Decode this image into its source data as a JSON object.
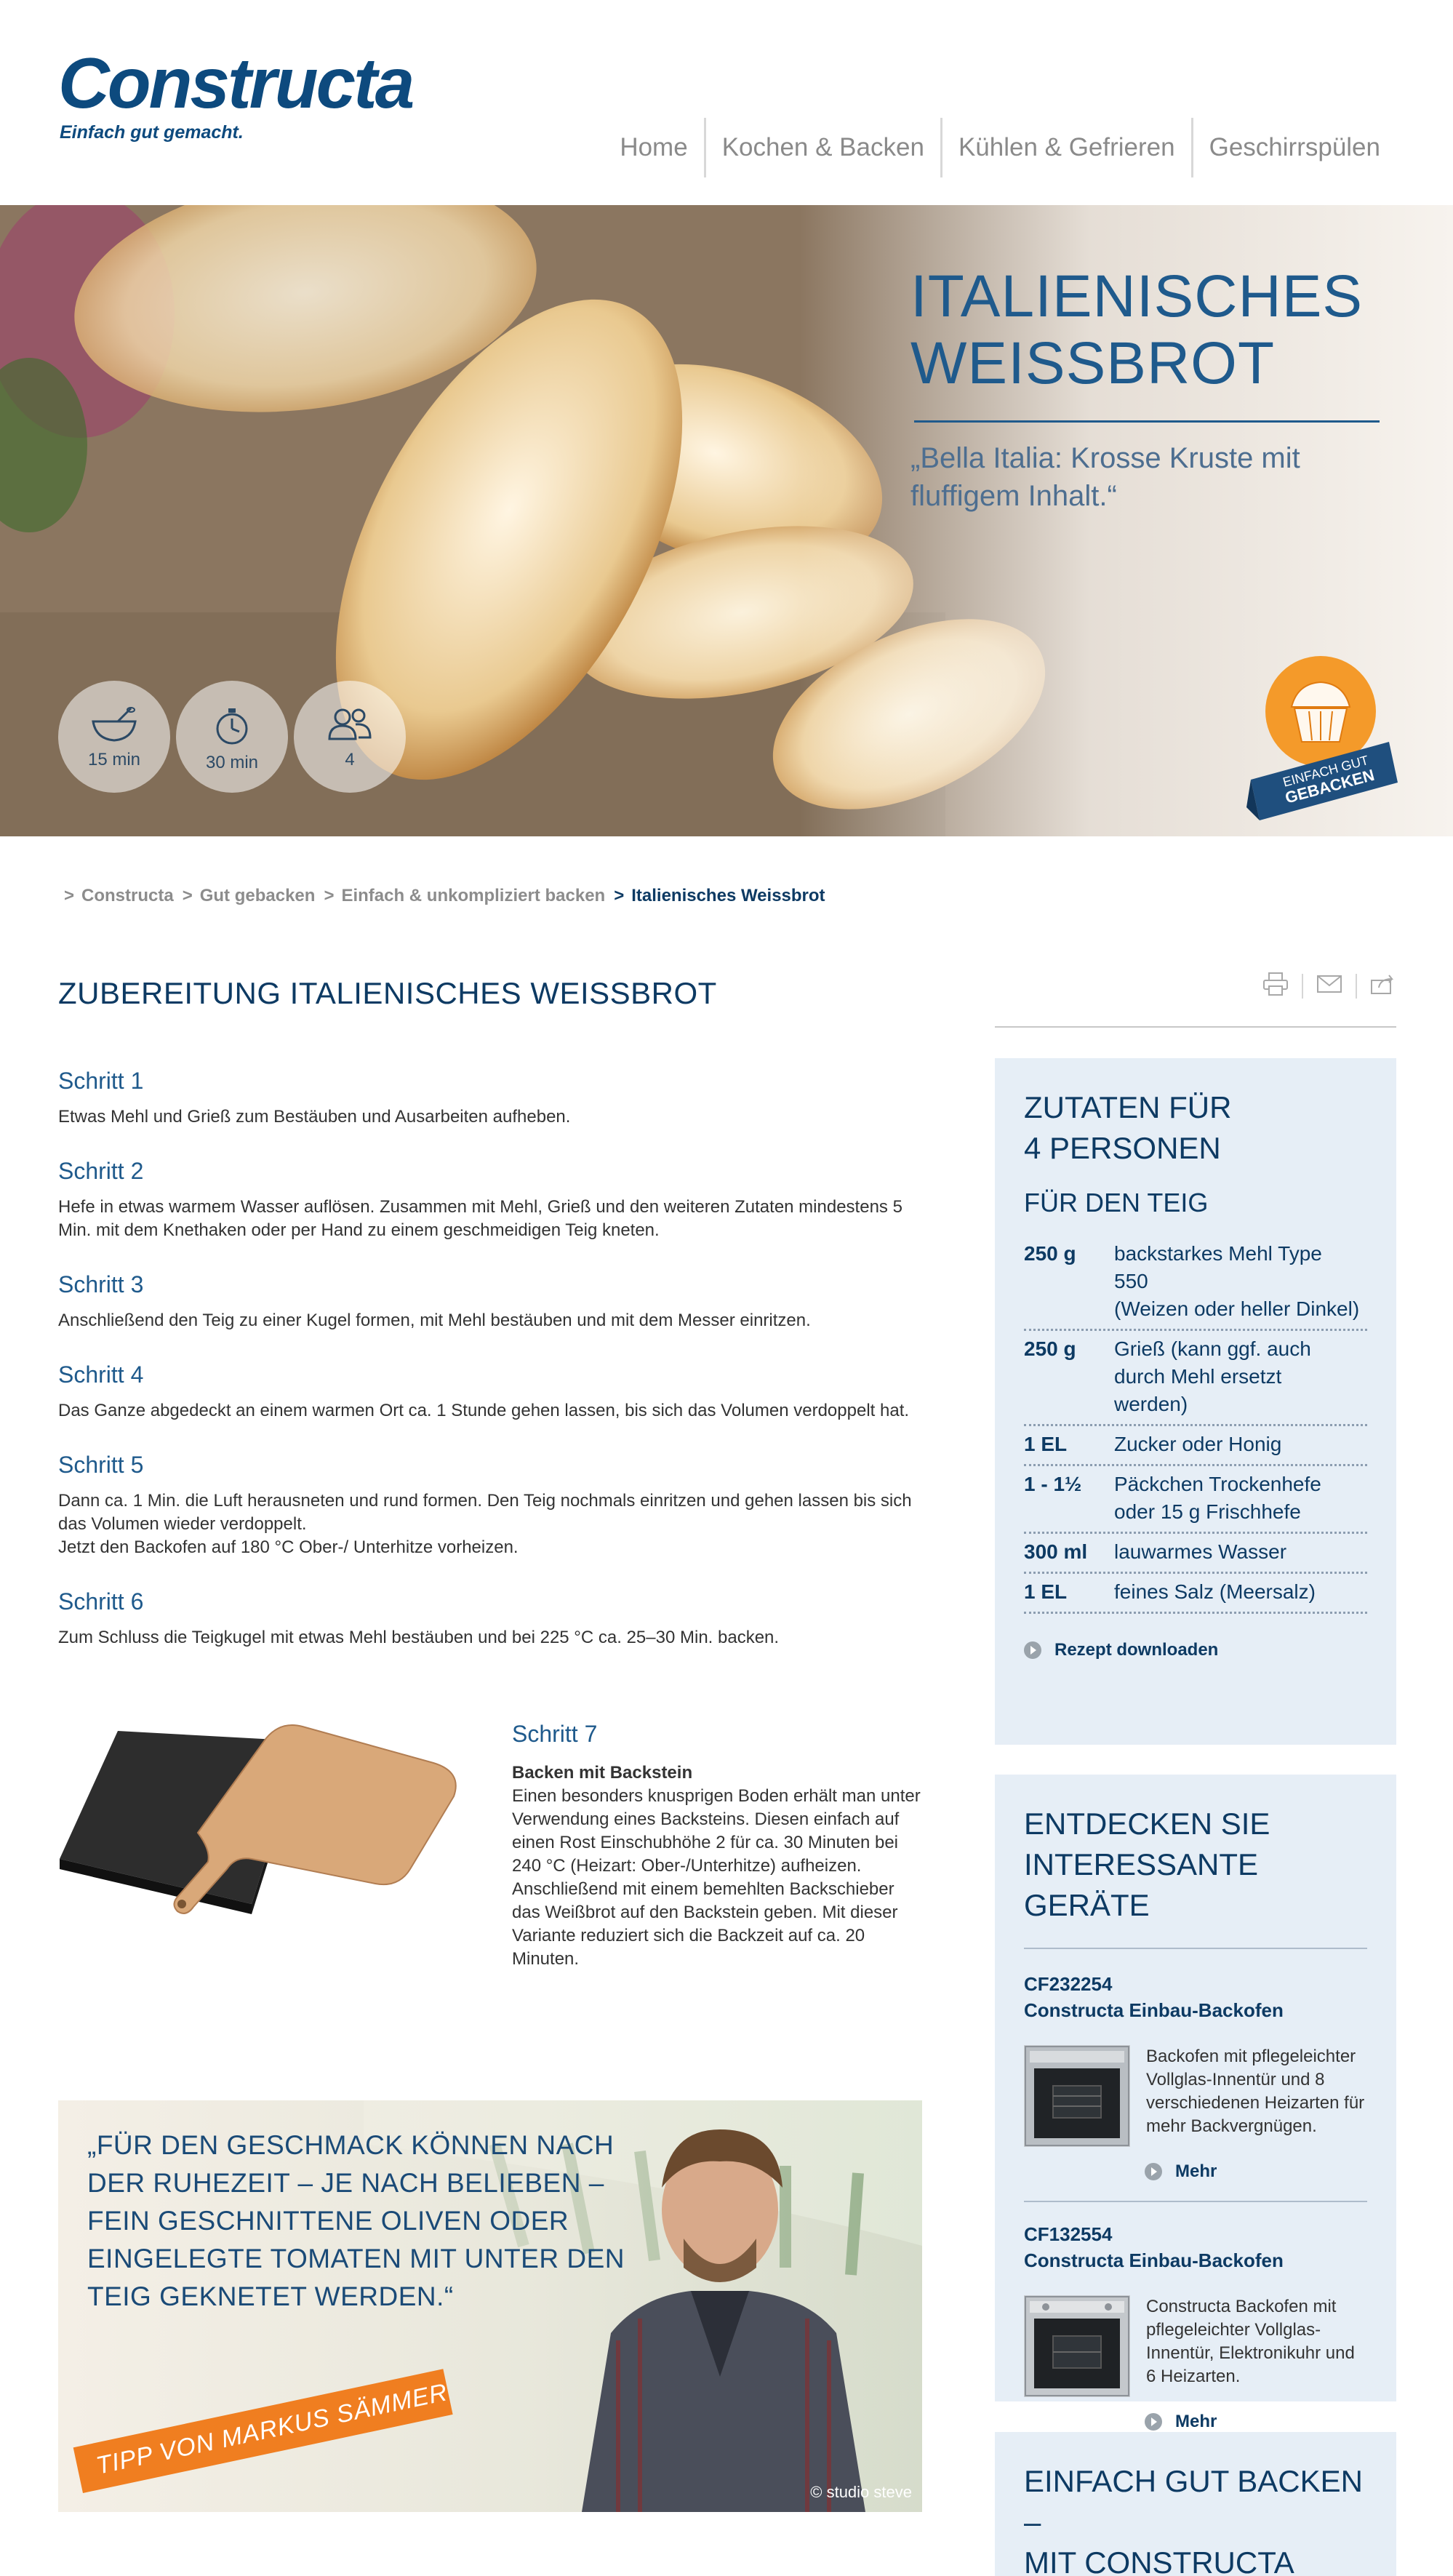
{
  "header": {
    "logo_word": "Constructa",
    "logo_tagline": "Einfach gut gemacht.",
    "nav": [
      "Home",
      "Kochen & Backen",
      "Kühlen & Gefrieren",
      "Geschirrspülen"
    ]
  },
  "hero": {
    "title_line1": "ITALIENISCHES",
    "title_line2": "WEISSBROT",
    "subtitle": "„Bella Italia: Krosse Kruste mit fluffigem Inhalt.“",
    "stats": [
      {
        "icon": "bowl-whisk-icon",
        "label": "15 min"
      },
      {
        "icon": "stopwatch-icon",
        "label": "30 min"
      },
      {
        "icon": "people-icon",
        "label": "4"
      }
    ],
    "badge_line1": "EINFACH GUT",
    "badge_line2": "GEBACKEN"
  },
  "breadcrumb": {
    "items": [
      "Constructa",
      "Gut gebacken",
      "Einfach & unkompliziert backen"
    ],
    "current": "Italienisches Weissbrot",
    "separator": ">"
  },
  "main": {
    "title": "ZUBEREITUNG ITALIENISCHES WEISSBROT",
    "steps": [
      {
        "title": "Schritt 1",
        "text": "Etwas Mehl und Grieß zum Bestäuben und Ausarbeiten aufheben."
      },
      {
        "title": "Schritt 2",
        "text": "Hefe in etwas warmem Wasser auflösen. Zusammen mit Mehl, Grieß und den weiteren Zutaten mindestens 5 Min. mit dem Knethaken oder per Hand zu einem geschmeidigen Teig kneten."
      },
      {
        "title": "Schritt 3",
        "text": "Anschließend den Teig zu einer Kugel formen, mit Mehl bestäuben und mit dem Messer einritzen."
      },
      {
        "title": "Schritt 4",
        "text": "Das Ganze abgedeckt an einem warmen Ort ca. 1 Stunde gehen lassen, bis sich das Volumen verdoppelt hat."
      },
      {
        "title": "Schritt 5",
        "text": "Dann ca. 1 Min. die Luft herausneten und rund formen. Den Teig nochmals einritzen und gehen lassen bis sich das Volumen wieder verdoppelt.\nJetzt den Backofen auf 180 °C Ober-/ Unterhitze vorheizen."
      },
      {
        "title": "Schritt 6",
        "text": "Zum Schluss die Teigkugel mit etwas Mehl bestäuben und bei 225 °C ca. 25–30 Min. backen."
      }
    ],
    "step7": {
      "title": "Schritt 7",
      "subtitle": "Backen mit Backstein",
      "text": "Einen besonders knusprigen Boden erhält man unter Verwendung eines Backsteins. Diesen einfach auf einen Rost Einschubhöhe 2 für ca. 30 Minuten bei 240 °C (Heizart: Ober-/Unterhitze) aufheizen. Anschließend mit einem bemehlten Backschieber das Weißbrot auf den Backstein geben. Mit dieser Variante reduziert sich die Backzeit auf ca. 20 Minuten."
    },
    "tip": {
      "quote": "„FÜR DEN GESCHMACK KÖNNEN NACH DER RUHEZEIT – JE NACH BELIEBEN – FEIN GESCHNITTENE OLIVEN ODER EINGELEGTE TOMATEN MIT UNTER DEN TEIG GEKNETET WERDEN.“",
      "ribbon": "TIPP VON MARKUS SÄMMER",
      "credit": "© studio steve"
    }
  },
  "ingredients": {
    "title_line1": "ZUTATEN FÜR",
    "title_line2": "4 PERSONEN",
    "section": "FÜR DEN TEIG",
    "rows": [
      {
        "amount": "250 g",
        "name": "backstarkes Mehl Type 550\n(Weizen oder heller Dinkel)"
      },
      {
        "amount": "250 g",
        "name": "Grieß (kann ggf. auch durch Mehl ersetzt werden)"
      },
      {
        "amount": "1 EL",
        "name": "Zucker oder Honig"
      },
      {
        "amount": "1 - 1½",
        "name": "Päckchen Trockenhefe oder 15 g Frischhefe"
      },
      {
        "amount": "300 ml",
        "name": "lauwarmes Wasser"
      },
      {
        "amount": "1 EL",
        "name": "feines Salz (Meersalz)"
      }
    ],
    "download_label": "Rezept downloaden"
  },
  "devices": {
    "title_line1": "ENTDECKEN SIE",
    "title_line2": "INTERESSANTE GERÄTE",
    "items": [
      {
        "code": "CF232254",
        "name": "Constructa Einbau-Backofen",
        "desc": "Backofen mit pflegeleichter Vollglas-Innentür und 8 verschiedenen Heizarten für mehr Backvergnügen.",
        "more": "Mehr"
      },
      {
        "code": "CF132554",
        "name": "Constructa Einbau-Backofen",
        "desc": "Constructa Backofen mit pflegeleichter Vollglas-Innentür, Elektronikuhr und 6 Heizarten.",
        "more": "Mehr"
      }
    ]
  },
  "promo": {
    "title_line1": "EINFACH GUT BACKEN –",
    "title_line2": "MIT CONSTRUCTA"
  },
  "colors": {
    "brand_blue": "#0d3a63",
    "accent_orange": "#f07e20",
    "panel_bg": "#e6eef6"
  }
}
